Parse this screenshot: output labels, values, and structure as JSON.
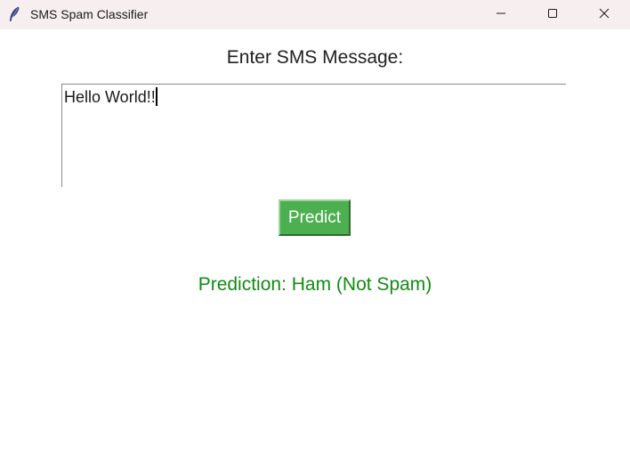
{
  "window": {
    "title": "SMS Spam Classifier",
    "icons": {
      "app": "feather-icon",
      "minimize": "minimize-icon",
      "maximize": "maximize-icon",
      "close": "close-icon"
    }
  },
  "form": {
    "prompt_label": "Enter SMS Message:",
    "message_value": "Hello World!!",
    "predict_label": "Predict"
  },
  "result": {
    "prediction_text": "Prediction: Ham (Not Spam)"
  },
  "colors": {
    "button_bg": "#4caf50",
    "prediction_text": "#138a13",
    "titlebar_bg": "#f7efef"
  }
}
